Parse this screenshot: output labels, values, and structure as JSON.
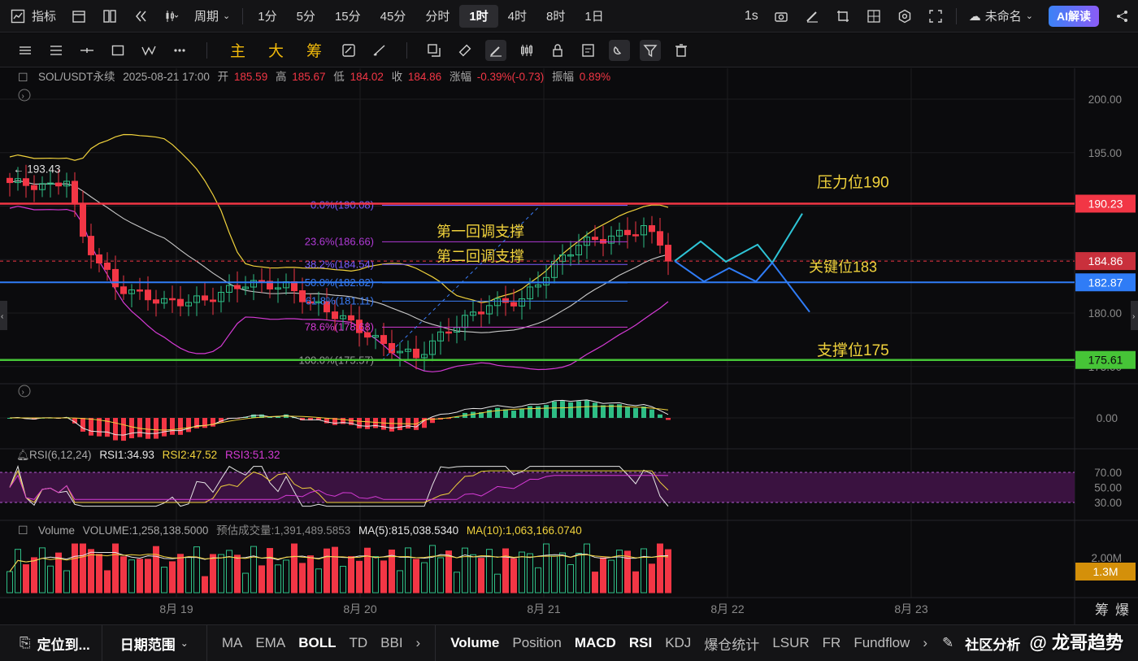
{
  "topbar": {
    "indicators_label": "指标",
    "period_label": "周期",
    "timeframes": [
      "1分",
      "5分",
      "15分",
      "45分",
      "分时",
      "1时",
      "4时",
      "8时",
      "1日"
    ],
    "active_timeframe": "1时",
    "seconds_label": "1s",
    "layout_name": "未命名",
    "ai_label": "AI解读"
  },
  "toolbar": {
    "indicator_main": "主",
    "indicator_big": "大",
    "indicator_chip": "筹"
  },
  "info": {
    "symbol": "SOL/USDT永续",
    "datetime": "2025-08-21 17:00",
    "open_label": "开",
    "open": "185.59",
    "high_label": "高",
    "high": "185.67",
    "low_label": "低",
    "low": "184.02",
    "close_label": "收",
    "close": "184.86",
    "change_label": "涨幅",
    "change": "-0.39%(-0.73)",
    "amp_label": "振幅",
    "amp": "0.89%"
  },
  "price_axis": {
    "ticks": [
      "200.00",
      "195.00",
      "180.00",
      "175.00"
    ],
    "tags": {
      "resistance": "190.23",
      "current": "184.86",
      "key": "182.87",
      "support": "175.61"
    }
  },
  "chart_data": {
    "type": "candlestick",
    "high_marker": "193.43",
    "fib_labels": [
      "0.0%(190.08)",
      "23.6%(186.66)",
      "38.2%(184.54)",
      "50.0%(182.82)",
      "61.8%(181.11)",
      "78.6%(178.68)",
      "100.0%(175.57)"
    ],
    "fib_values": [
      190.08,
      186.66,
      184.54,
      182.82,
      181.11,
      178.68,
      175.57
    ],
    "levels": {
      "resistance": 190.23,
      "current": 184.86,
      "key": 182.87,
      "support": 175.61
    },
    "annotations": {
      "first_support": "第一回调支撑",
      "second_support": "第二回调支撑",
      "resistance": "压力位190",
      "key": "关键位183",
      "support": "支撑位175"
    },
    "x_labels": [
      "8月 19",
      "8月 20",
      "8月 21",
      "8月 22",
      "8月 23"
    ],
    "colors": {
      "up": "#2ebd85",
      "down": "#f23645",
      "boll_upper": "#f0d23c",
      "boll_lower": "#d43ad4",
      "boll_mid": "#c8c8c8",
      "resistance": "#f23645",
      "key": "#2f7cf6",
      "support": "#46c437",
      "projection": "#2ec4d6"
    }
  },
  "macd": {
    "zero": "0.00"
  },
  "rsi": {
    "label": "RSI(6,12,24)",
    "rsi1": "RSI1:34.93",
    "rsi2": "RSI2:47.52",
    "rsi3": "RSI3:51.32",
    "ticks": [
      "70.00",
      "50.00",
      "30.00"
    ]
  },
  "volume": {
    "label": "Volume",
    "volume": "VOLUME:1,258,138.5000",
    "estimate": "预估成交量:1,391,489.5853",
    "ma5": "MA(5):815,038.5340",
    "ma10": "MA(10):1,063,166.0740",
    "ticks": [
      "2.00M"
    ],
    "tag": "1.3M"
  },
  "corner": {
    "chip": "筹",
    "burst": "爆"
  },
  "bottombar": {
    "locate": "定位到...",
    "date_range": "日期范围",
    "main_indicators": [
      "MA",
      "EMA",
      "BOLL",
      "TD",
      "BBI"
    ],
    "sub_indicators": [
      "Volume",
      "Position",
      "MACD",
      "RSI",
      "KDJ",
      "爆仓统计",
      "LSUR",
      "FR",
      "Fundflow"
    ],
    "community": "社区分析"
  },
  "watermark": "@ 龙哥趋势"
}
